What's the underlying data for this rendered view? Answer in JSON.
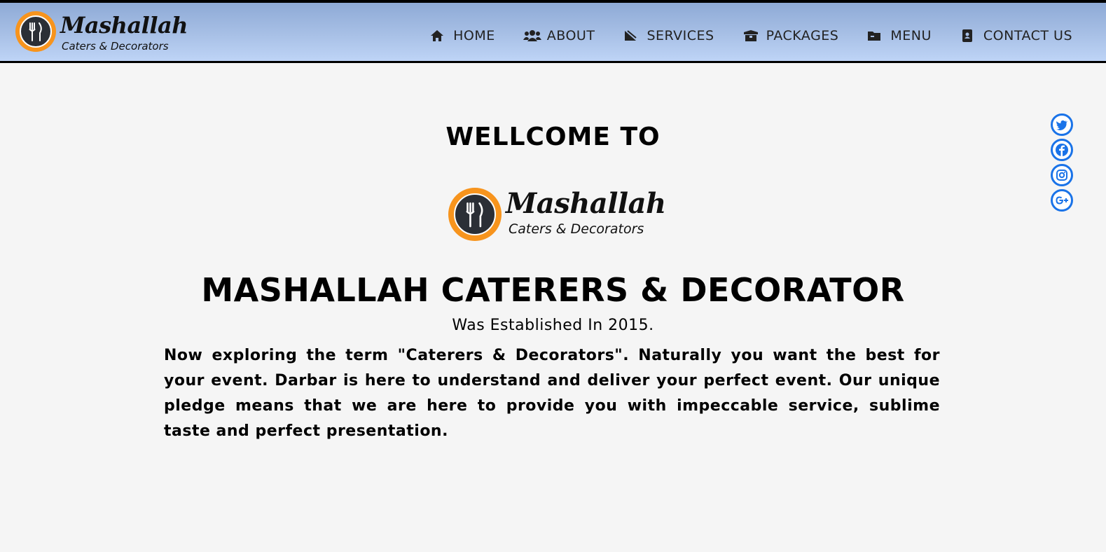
{
  "header": {
    "brand": {
      "name": "Mashallah",
      "tagline": "Caters & Decorators"
    },
    "nav": [
      {
        "label": "HOME",
        "icon": "home-icon"
      },
      {
        "label": "ABOUT",
        "icon": "users-icon"
      },
      {
        "label": "SERVICES",
        "icon": "services-icon"
      },
      {
        "label": "PACKAGES",
        "icon": "box-icon"
      },
      {
        "label": "MENU",
        "icon": "folder-icon"
      },
      {
        "label": "CONTACT US",
        "icon": "contact-icon"
      }
    ]
  },
  "social": [
    {
      "icon": "twitter-icon"
    },
    {
      "icon": "facebook-icon"
    },
    {
      "icon": "instagram-icon"
    },
    {
      "icon": "google-plus-icon"
    }
  ],
  "main": {
    "welcome": "WELLCOME TO",
    "logo": {
      "name": "Mashallah",
      "tagline": "Caters & Decorators"
    },
    "title": "MASHALLAH CATERERS & DECORATOR",
    "subtitle": "Was Established In 2015.",
    "paragraph": "Now exploring the term \"Caterers & Decorators\". Naturally you want the best for your event. Darbar is here to understand and deliver your perfect event. Our unique pledge means that we are here to provide you with impeccable service, sublime taste and perfect presentation."
  },
  "colors": {
    "header_gradient_top": "#8eaad6",
    "header_gradient_bottom": "#bed4f6",
    "logo_orange": "#f7941d",
    "social_blue": "#1a73e8",
    "page_bg": "#f5f5f5"
  }
}
